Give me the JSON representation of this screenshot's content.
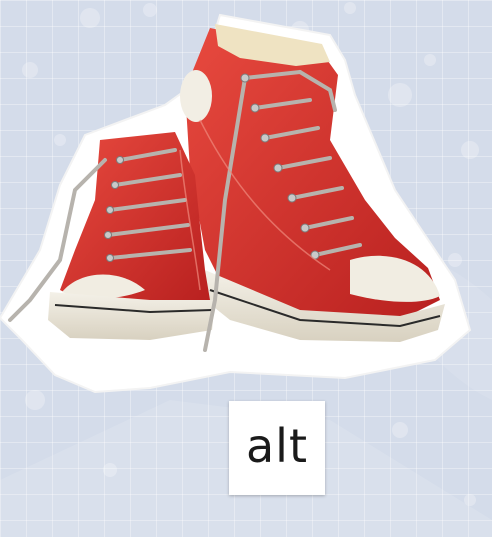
{
  "card": {
    "word": "alt"
  },
  "picture": {
    "subject_icon": "red-high-top-sneakers",
    "colors": {
      "background": "#d4dcea",
      "shoe_red": "#d9302e",
      "shoe_red_dark": "#a91e1f",
      "sole": "#ece7da",
      "lace": "#b7b3ad",
      "card": "#ffffff"
    }
  }
}
